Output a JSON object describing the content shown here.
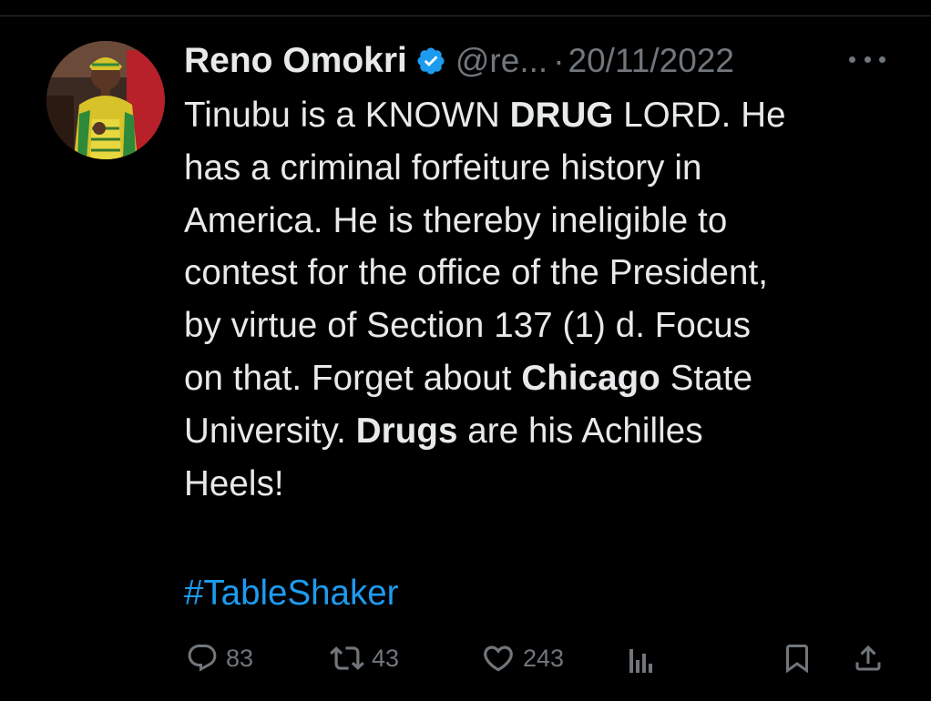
{
  "tweet": {
    "display_name": "Reno Omokri",
    "handle": "@re...",
    "separator": "·",
    "timestamp": "20/11/2022",
    "lines": [
      [
        {
          "t": "Tinubu is a KNOWN "
        },
        {
          "t": "DRUG",
          "b": true
        },
        {
          "t": " LORD. He"
        }
      ],
      [
        {
          "t": "has a criminal forfeiture history in"
        }
      ],
      [
        {
          "t": "America. He is thereby ineligible to"
        }
      ],
      [
        {
          "t": "contest for the office of the President,"
        }
      ],
      [
        {
          "t": "by virtue of Section 137 (1) d. Focus"
        }
      ],
      [
        {
          "t": "on that. Forget about "
        },
        {
          "t": "Chicago",
          "b": true
        },
        {
          "t": " State"
        }
      ],
      [
        {
          "t": "University. "
        },
        {
          "t": "Drugs",
          "b": true
        },
        {
          "t": " are his Achilles"
        }
      ],
      [
        {
          "t": "Heels!"
        }
      ]
    ],
    "hashtag": "#TableShaker"
  },
  "actions": {
    "replies": "83",
    "retweets": "43",
    "likes": "243"
  },
  "icons": {
    "verified": "verified-badge-icon",
    "more": "more-icon",
    "reply": "reply-icon",
    "retweet": "retweet-icon",
    "like": "heart-icon",
    "views": "views-icon",
    "bookmark": "bookmark-icon",
    "share": "share-icon"
  },
  "colors": {
    "background": "#000000",
    "text": "#e7e9ea",
    "muted": "#71767b",
    "accent": "#1d9bf0"
  }
}
